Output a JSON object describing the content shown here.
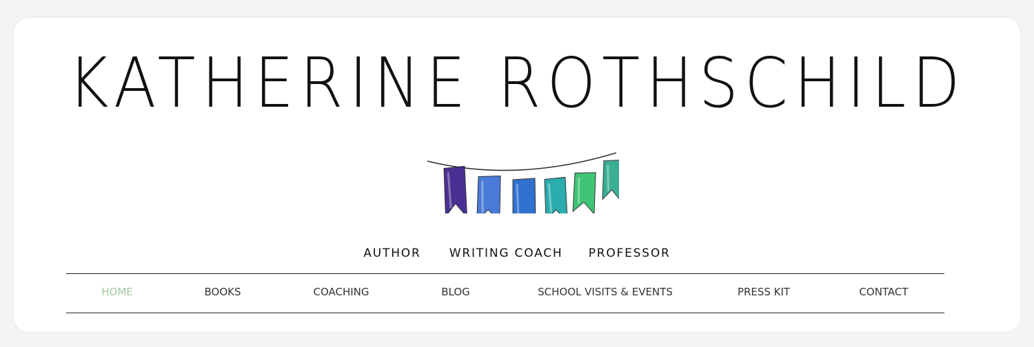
{
  "header": {
    "site_title": "KATHERINE ROTHSCHILD",
    "bunting_icon": "bunting-flags-icon",
    "bunting_colors": [
      "#3b1f8a",
      "#3a6fd6",
      "#1f66cc",
      "#1aa6a8",
      "#2fc06a",
      "#2aa88a"
    ]
  },
  "tagline": {
    "items": [
      "AUTHOR",
      "WRITING COACH",
      "PROFESSOR"
    ]
  },
  "nav": {
    "active_color": "#9ec99e",
    "items": [
      {
        "label": "HOME",
        "active": true
      },
      {
        "label": "BOOKS"
      },
      {
        "label": "COACHING"
      },
      {
        "label": "BLOG"
      },
      {
        "label": "SCHOOL VISITS & EVENTS"
      },
      {
        "label": "PRESS KIT"
      },
      {
        "label": "CONTACT"
      }
    ]
  }
}
